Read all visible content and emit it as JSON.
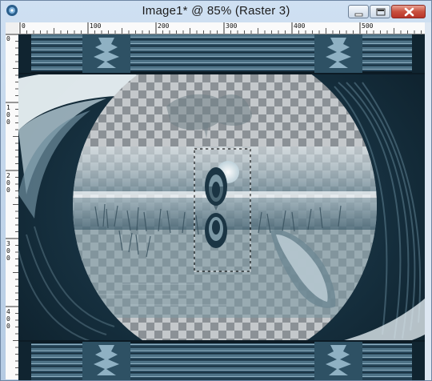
{
  "window": {
    "title": "Image1* @  85% (Raster 3)",
    "buttons": [
      "minimize",
      "maximize",
      "close"
    ]
  },
  "ruler": {
    "top_labels": [
      "0",
      "100",
      "200",
      "300",
      "400",
      "500"
    ],
    "left_labels": [
      "0",
      "1\n0\n0",
      "2\n0\n0",
      "3\n0\n0",
      "4\n0\n0"
    ]
  },
  "icons": {
    "app": "paint-shop-pro-icon",
    "minimize": "minimize-icon",
    "maximize": "maximize-icon",
    "close": "close-icon"
  },
  "colors": {
    "frame_dark": "#1d3a4c",
    "frame_mid": "#4d6f82",
    "frame_light": "#b9d0dd",
    "accent_close": "#c44a3a"
  },
  "canvas": {
    "zoom": "85%",
    "layer": "Raster 3"
  }
}
